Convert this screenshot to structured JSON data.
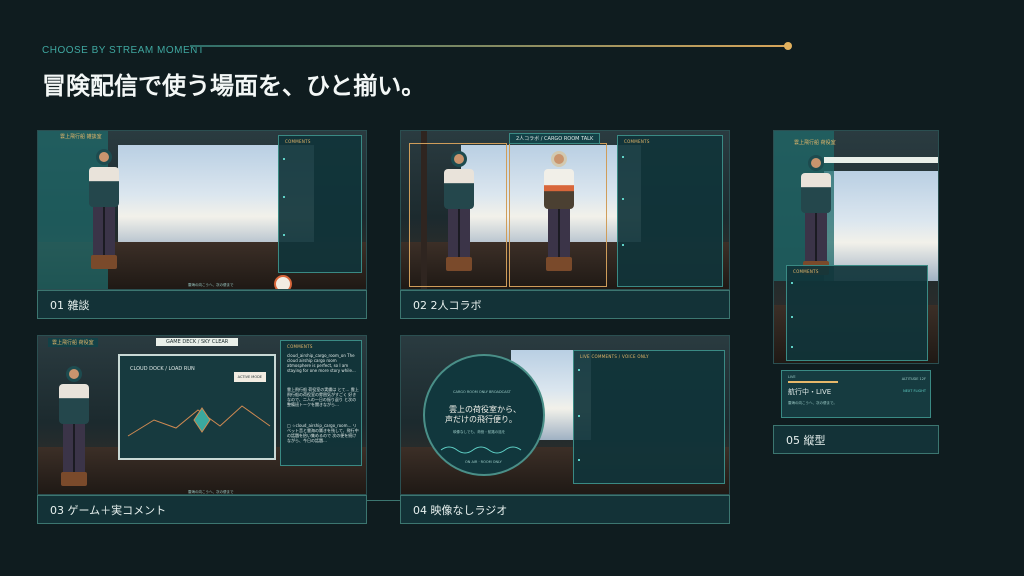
{
  "header": {
    "eyebrow": "CHOOSE BY STREAM MOMENT",
    "title": "冒険配信で使う場面を、ひと揃い。"
  },
  "cards": [
    {
      "label": "01 雑談",
      "overlay_title": "雲上飛行船 雑談室",
      "comments_title": "COMMENTS",
      "comments_link": "",
      "caption": "雲海の向こうへ、次の便まで"
    },
    {
      "label": "02 2人コラボ",
      "overlay_title": "2人コラボ / CARGO ROOM TALK",
      "comments_title": "COMMENTS"
    },
    {
      "label": "03 ゲーム＋実コメント",
      "overlay_title": "雲上飛行船 荷役室",
      "game_title": "GAME DECK / SKY CLEAR",
      "chart_title": "CLOUD DOCK / LOAD RUN",
      "button": "ACTIVE MODE",
      "comments_title": "COMMENTS",
      "comments": [
        "cloud_airship_cargo_room_on The cloud airship cargo room atmosphere is perfect, so I am staying for one more story while...",
        "雲上飛行船 荷役室の実績は とて… 雲上飛行船の荷役室の雰囲気がすごく 好きなので、二人の一日の振り返り と次の整備班トークを聞きながら…",
        "□ ☆cloud_airship_cargo_room… リベット音と雲海の響きを残して、飛行中の話題を拾い集めるので 次の便を続けながら、今日の話題…"
      ],
      "caption": "雲海の向こうへ、次の便まで"
    },
    {
      "label": "04 映像なしラジオ",
      "radio_small": "CARGO ROOM ONLY BROADCAST",
      "radio_line1": "雲上の荷役室から、",
      "radio_line2": "声だけの飛行便り。",
      "radio_sub": "映像なしでも、荷役・航路の話を",
      "radio_footer": "ON AIR · ROOM ONLY",
      "comments_title": "LIVE COMMENTS / VOICE ONLY"
    },
    {
      "label": "05 縦型",
      "overlay_title": "雲上飛行船 荷役室",
      "comments_title": "COMMENTS",
      "status_small": "LIVE",
      "status_text": "航行中・LIVE",
      "status_sub": "雲海の向こうへ、次の便まで。",
      "status_right": "ALTITUDE 12F",
      "next": "NEXT FLIGHT"
    }
  ]
}
